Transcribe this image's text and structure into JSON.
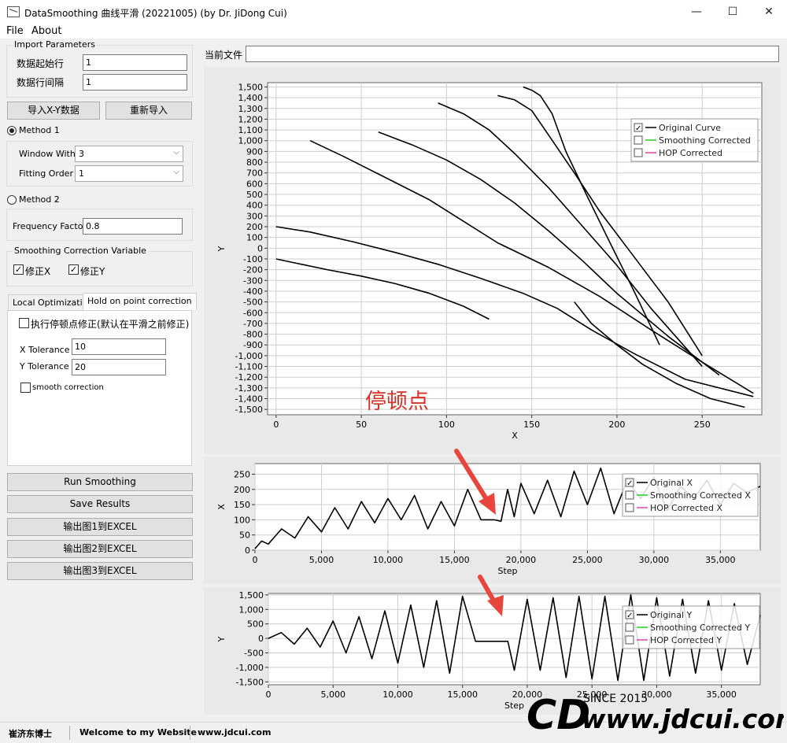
{
  "window": {
    "title": "DataSmoothing 曲线平滑 (20221005) (by Dr. JiDong Cui)",
    "min": "—",
    "max": "☐",
    "close": "✕"
  },
  "menu": {
    "file": "File",
    "about": "About"
  },
  "import_params": {
    "title": "Import Parameters",
    "start_row_label": "数据起始行",
    "start_row_value": "1",
    "interval_label": "数据行间隔",
    "interval_value": "1",
    "import_btn": "导入X-Y数据",
    "reimport_btn": "重新导入"
  },
  "method1": {
    "label": "Method 1",
    "selected": true,
    "window_label": "Window With",
    "window_value": "3",
    "order_label": "Fitting Order",
    "order_value": "1"
  },
  "method2": {
    "label": "Method 2",
    "selected": false,
    "freq_label": "Frequency Factor",
    "freq_value": "0.8"
  },
  "correction_var": {
    "title": "Smoothing Correction Variable",
    "x_label": "修正X",
    "x_checked": true,
    "y_label": "修正Y",
    "y_checked": true
  },
  "tabs": [
    {
      "label": "Local Optimization",
      "active": false
    },
    {
      "label": "Hold on point correction",
      "active": true
    }
  ],
  "hold_point": {
    "exec_label": "执行停顿点修正(默认在平滑之前修正)",
    "exec_checked": false,
    "x_tol_label": "X Tolerance",
    "x_tol_value": "10",
    "y_tol_label": "Y Tolerance",
    "y_tol_value": "20",
    "smooth_corr_label": "smooth correction",
    "smooth_corr_checked": false
  },
  "actions": {
    "run": "Run Smoothing",
    "save": "Save Results",
    "export1": "输出图1到EXCEL",
    "export2": "输出图2到EXCEL",
    "export3": "输出图3到EXCEL"
  },
  "current_file": {
    "label": "当前文件",
    "value": ""
  },
  "annotation": "停顿点",
  "colors": {
    "original": "#000000",
    "smoothing": "#22cc22",
    "hop": "#dd44aa",
    "arrow": "#e8453c",
    "annotation": "#d93025",
    "plot_bg": "#ffffff",
    "grid": "#cfcfcf"
  },
  "statusbar": {
    "author": "崔济东博士",
    "welcome": "Welcome to my Website",
    "site": "www.jdcui.com"
  },
  "watermark": {
    "since": "SINCE 2015",
    "url": "www.jdcui.com",
    "logo": "CD"
  },
  "chart_data": [
    {
      "type": "line",
      "xlabel": "X",
      "ylabel": "Y",
      "xlim": [
        -5,
        285
      ],
      "ylim": [
        -1550,
        1540
      ],
      "x_ticks": [
        "0",
        "50",
        "100",
        "150",
        "200",
        "250"
      ],
      "y_ticks": [
        "1,500",
        "1,400",
        "1,300",
        "1,200",
        "1,100",
        "1,000",
        "900",
        "800",
        "700",
        "600",
        "500",
        "400",
        "300",
        "200",
        "100",
        "0",
        "-100",
        "-200",
        "-300",
        "-400",
        "-500",
        "-600",
        "-700",
        "-800",
        "-900",
        "-1,000",
        "-1,100",
        "-1,200",
        "-1,300",
        "-1,400",
        "-1,500"
      ],
      "legend": [
        {
          "label": "Original Curve",
          "checked": true
        },
        {
          "label": "Smoothing Corrected",
          "checked": false
        },
        {
          "label": "HOP Corrected",
          "checked": false
        }
      ],
      "legend_position": "top-right",
      "series": [
        {
          "name": "Original Curve",
          "x": [
            0,
            20,
            45,
            70,
            95,
            120,
            145,
            165,
            185,
            210,
            240,
            280
          ],
          "y": [
            200,
            150,
            60,
            -40,
            -150,
            -280,
            -420,
            -560,
            -760,
            -980,
            -1220,
            -1380
          ]
        },
        {
          "name": "Original Curve",
          "x": [
            20,
            40,
            65,
            90,
            110,
            130,
            160,
            190,
            220,
            250,
            280
          ],
          "y": [
            1000,
            850,
            650,
            450,
            250,
            50,
            -180,
            -450,
            -760,
            -1060,
            -1350
          ]
        },
        {
          "name": "Original Curve",
          "x": [
            60,
            80,
            100,
            120,
            140,
            160,
            180,
            200,
            230,
            260
          ],
          "y": [
            1080,
            960,
            820,
            640,
            420,
            160,
            -120,
            -420,
            -820,
            -1180
          ]
        },
        {
          "name": "Original Curve",
          "x": [
            95,
            110,
            125,
            140,
            160,
            180,
            200,
            220,
            250
          ],
          "y": [
            1350,
            1250,
            1100,
            880,
            560,
            200,
            -160,
            -560,
            -1100
          ]
        },
        {
          "name": "Original Curve",
          "x": [
            130,
            140,
            150,
            160,
            175,
            190,
            210,
            230,
            250
          ],
          "y": [
            1420,
            1380,
            1280,
            1050,
            700,
            340,
            -80,
            -500,
            -1000
          ]
        },
        {
          "name": "Original Curve",
          "x": [
            145,
            150,
            155,
            162,
            170,
            182,
            195,
            210,
            225
          ],
          "y": [
            1500,
            1470,
            1420,
            1250,
            900,
            500,
            80,
            -400,
            -900
          ]
        },
        {
          "name": "Original Curve",
          "x": [
            0,
            15,
            30,
            50,
            70,
            90,
            110,
            125
          ],
          "y": [
            -100,
            -150,
            -200,
            -260,
            -330,
            -420,
            -540,
            -660
          ]
        },
        {
          "name": "Original Curve",
          "x": [
            175,
            185,
            200,
            215,
            235,
            255,
            275
          ],
          "y": [
            -500,
            -700,
            -900,
            -1080,
            -1260,
            -1400,
            -1480
          ]
        }
      ]
    },
    {
      "type": "line",
      "xlabel": "Step",
      "ylabel": "X",
      "xlim": [
        0,
        38000
      ],
      "ylim": [
        0,
        285
      ],
      "x_ticks": [
        "0",
        "5,000",
        "10,000",
        "15,000",
        "20,000",
        "25,000",
        "30,000",
        "35,000"
      ],
      "y_ticks": [
        "250",
        "200",
        "150",
        "100",
        "50",
        "0"
      ],
      "legend": [
        {
          "label": "Original X",
          "checked": true
        },
        {
          "label": "Smoothing Corrected X",
          "checked": false
        },
        {
          "label": "HOP Corrected X",
          "checked": false
        }
      ],
      "legend_position": "top-right",
      "series": [
        {
          "name": "Original X",
          "x": [
            0,
            500,
            1000,
            2000,
            3000,
            4000,
            5000,
            6000,
            7000,
            8000,
            9000,
            10000,
            11000,
            12000,
            13000,
            14000,
            15000,
            16000,
            17000,
            18000,
            18500,
            19000,
            19500,
            20000,
            21000,
            22000,
            23000,
            24000,
            25000,
            26000,
            27000,
            28000,
            29000,
            30000,
            31000,
            32000,
            33000,
            34000,
            35000,
            36000,
            37000,
            38000
          ],
          "y": [
            5,
            30,
            20,
            70,
            40,
            110,
            60,
            140,
            70,
            160,
            90,
            170,
            100,
            180,
            70,
            160,
            80,
            200,
            100,
            100,
            95,
            200,
            110,
            220,
            120,
            230,
            110,
            260,
            150,
            270,
            120,
            230,
            170,
            240,
            130,
            210,
            170,
            230,
            150,
            220,
            190,
            210
          ]
        }
      ]
    },
    {
      "type": "line",
      "xlabel": "Step",
      "ylabel": "Y",
      "xlim": [
        0,
        38000
      ],
      "ylim": [
        -1600,
        1550
      ],
      "x_ticks": [
        "0",
        "5,000",
        "10,000",
        "15,000",
        "20,000",
        "25,000",
        "30,000",
        "35,000"
      ],
      "y_ticks": [
        "1,500",
        "1,000",
        "500",
        "0",
        "-500",
        "-1,000",
        "-1,500"
      ],
      "legend": [
        {
          "label": "Original Y",
          "checked": true
        },
        {
          "label": "Smoothing Corrected Y",
          "checked": false
        },
        {
          "label": "HOP Corrected Y",
          "checked": false
        }
      ],
      "legend_position": "top-right",
      "series": [
        {
          "name": "Original Y",
          "x": [
            0,
            1000,
            2000,
            3000,
            4000,
            5000,
            6000,
            7000,
            8000,
            9000,
            10000,
            11000,
            12000,
            13000,
            14000,
            15000,
            16000,
            16500,
            18000,
            18500,
            19000,
            20000,
            21000,
            22000,
            23000,
            24000,
            25000,
            26000,
            27000,
            28000,
            29000,
            30000,
            31000,
            32000,
            33000,
            34000,
            35000,
            36000,
            37000,
            38000
          ],
          "y": [
            0,
            200,
            -200,
            350,
            -300,
            600,
            -500,
            750,
            -700,
            950,
            -850,
            1150,
            -1000,
            1300,
            -1200,
            1450,
            -100,
            -100,
            -100,
            -100,
            -1100,
            1350,
            -1100,
            1400,
            -1350,
            1450,
            -1400,
            1450,
            -1450,
            1500,
            -1450,
            1400,
            -1300,
            1350,
            -1200,
            1300,
            -1100,
            1200,
            -900,
            800
          ]
        }
      ]
    }
  ]
}
